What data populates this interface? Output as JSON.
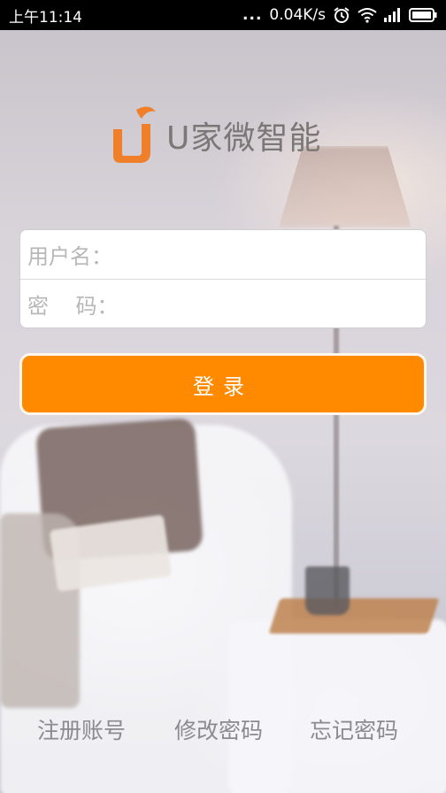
{
  "status_bar": {
    "time": "上午11:14",
    "overflow_dots": "...",
    "net_speed": "0.04K/s",
    "icons": [
      "alarm-icon",
      "wifi-icon",
      "signal-icon",
      "battery-icon"
    ]
  },
  "logo": {
    "app_name": "U家微智能",
    "brand_color": "#f07f2a"
  },
  "form": {
    "username_label": "用户名：",
    "username_value": "",
    "password_label": "密    码：",
    "password_value": ""
  },
  "login_button": {
    "label": "登录",
    "color": "#ff8a00"
  },
  "links": {
    "register": "注册账号",
    "change_password": "修改密码",
    "forgot_password": "忘记密码"
  }
}
